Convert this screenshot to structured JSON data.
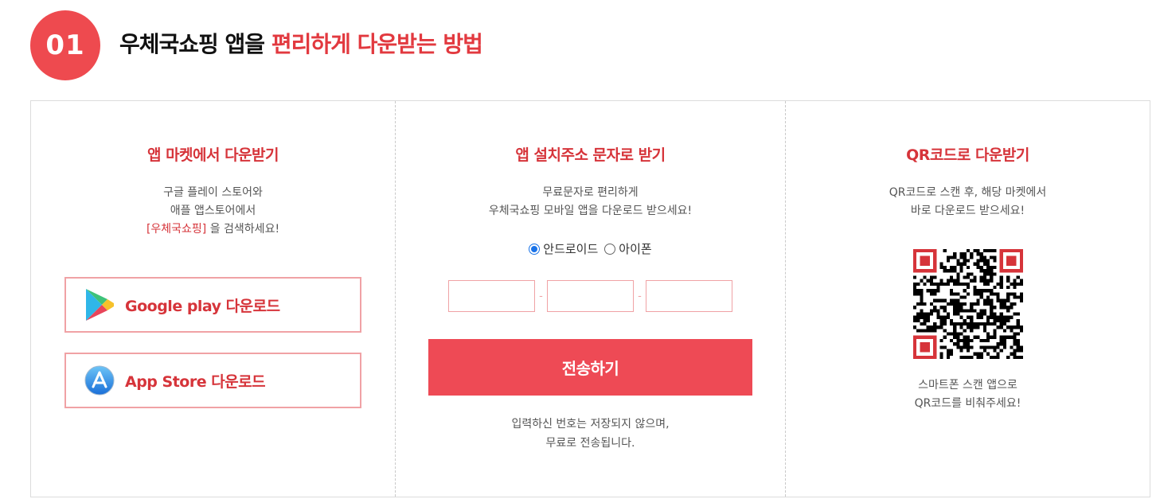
{
  "header": {
    "step_number": "01",
    "title_plain": "우체국쇼핑 앱을 ",
    "title_accent": "편리하게 다운받는 방법"
  },
  "market": {
    "title": "앱 마켓에서 다운받기",
    "desc_line1": "구글 플레이 스토어와",
    "desc_line2": "애플 앱스토어에서",
    "desc_keyword": "[우체국쇼핑]",
    "desc_suffix": " 을 검색하세요!",
    "google_label": "Google play 다운로드",
    "google_icon": "google-play-icon",
    "apple_label": "App Store 다운로드",
    "apple_icon": "app-store-icon"
  },
  "sms": {
    "title": "앱 설치주소 문자로 받기",
    "desc_line1": "무료문자로 편리하게",
    "desc_line2": "우체국쇼핑 모바일 앱을 다운로드 받으세요!",
    "radio_android": "안드로이드",
    "radio_iphone": "아이폰",
    "selected": "android",
    "phone1": "",
    "phone2": "",
    "phone3": "",
    "dash": "-",
    "send_label": "전송하기",
    "notice_line1": "입력하신 번호는 저장되지 않으며,",
    "notice_line2": "무료로 전송됩니다."
  },
  "qr": {
    "title": "QR코드로 다운받기",
    "desc_line1": "QR코드로 스캔 후, 해당 마켓에서",
    "desc_line2": "바로 다운로드 받으세요!",
    "foot_line1": "스마트폰 스캔 앱으로",
    "foot_line2": "QR코드를 비춰주세요!"
  },
  "colors": {
    "accent": "#ee4a4f",
    "accent_text": "#d6343a",
    "button_border": "#f0a2a5"
  }
}
